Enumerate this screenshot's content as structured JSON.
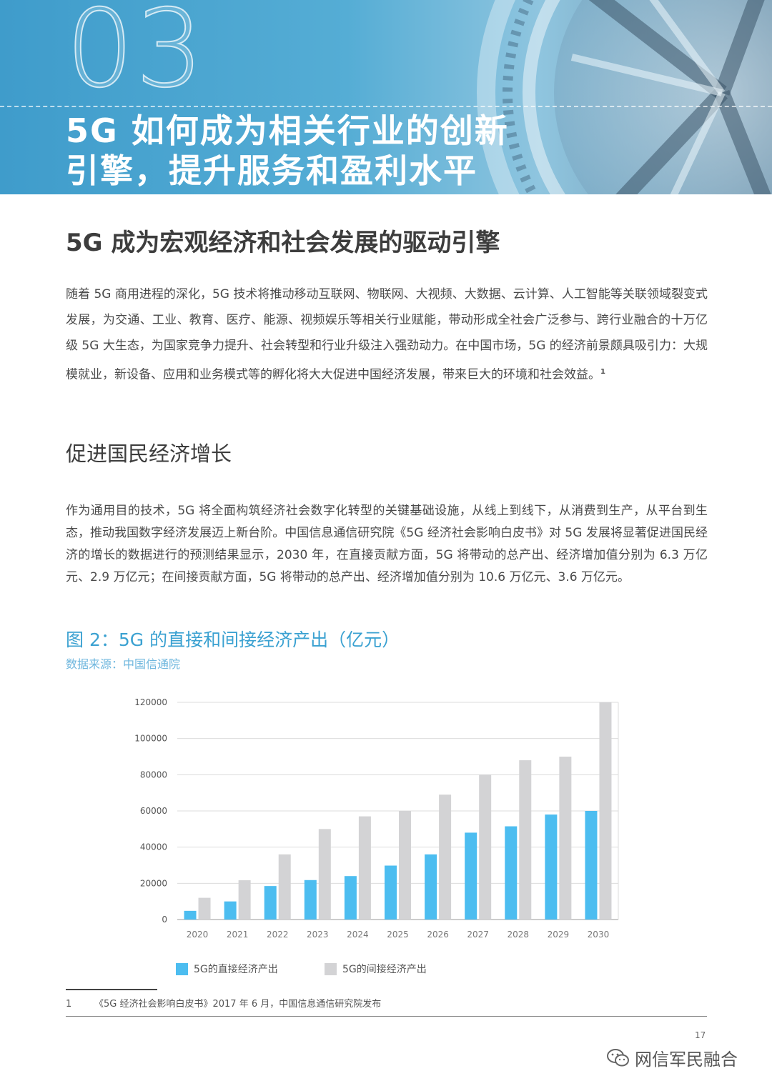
{
  "banner": {
    "chapter_number": "03",
    "title_lines": [
      "5G 如何成为相关行业的创新",
      "引擎，提升服务和盈利水平"
    ]
  },
  "section": {
    "heading": "5G 成为宏观经济和社会发展的驱动引擎",
    "paragraph1": "随着 5G 商用进程的深化，5G 技术将推动移动互联网、物联网、大视频、大数据、云计算、人工智能等关联领域裂变式发展，为交通、工业、教育、医疗、能源、视频娱乐等相关行业赋能，带动形成全社会广泛参与、跨行业融合的十万亿级 5G 大生态，为国家竞争力提升、社会转型和行业升级注入强劲动力。在中国市场，5G 的经济前景颇具吸引力：大规模就业，新设备、应用和业务模式等的孵化将大大促进中国经济发展，带来巨大的环境和社会效益。",
    "paragraph1_footnote_ref": "1",
    "subheading": "促进国民经济增长",
    "paragraph2": "作为通用目的技术，5G 将全面构筑经济社会数字化转型的关键基础设施，从线上到线下，从消费到生产，从平台到生态，推动我国数字经济发展迈上新台阶。中国信息通信研究院《5G 经济社会影响白皮书》对 5G 发展将显著促进国民经济的增长的数据进行的预测结果显示，2030 年，在直接贡献方面，5G 将带动的总产出、经济增加值分别为 6.3 万亿元、2.9 万亿元；在间接贡献方面，5G 将带动的总产出、经济增加值分别为 10.6 万亿元、3.6 万亿元。"
  },
  "figure": {
    "title": "图 2：5G 的直接和间接经济产出（亿元）",
    "source": "数据来源：中国信通院"
  },
  "chart_data": {
    "type": "bar",
    "categories": [
      "2020",
      "2021",
      "2022",
      "2023",
      "2024",
      "2025",
      "2026",
      "2027",
      "2028",
      "2029",
      "2030"
    ],
    "series": [
      {
        "name": "5G的直接经济产出",
        "color": "#4cbdf0",
        "values": [
          4800,
          10000,
          18500,
          21800,
          24000,
          29800,
          36000,
          48000,
          51500,
          58000,
          60000
        ]
      },
      {
        "name": "5G的间接经济产出",
        "color": "#d3d3d5",
        "values": [
          12000,
          21700,
          36000,
          50000,
          57000,
          60000,
          69000,
          80000,
          88000,
          90000,
          120000
        ]
      }
    ],
    "ylim": [
      0,
      120000
    ],
    "yticks": [
      "0",
      "20000",
      "40000",
      "60000",
      "80000",
      "100000",
      "120000"
    ],
    "grid": true,
    "legend_position": "bottom"
  },
  "footnote": {
    "number": "1",
    "text": "《5G 经济社会影响白皮书》2017 年 6 月，中国信息通信研究院发布"
  },
  "page_number": "17",
  "watermark": {
    "text": "网信军民融合",
    "icon": "wechat-icon"
  }
}
